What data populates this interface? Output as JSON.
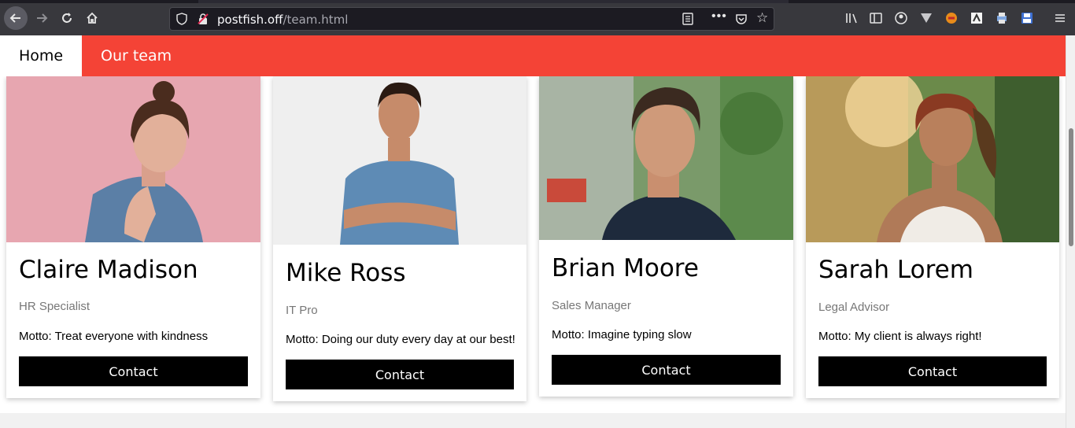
{
  "browser": {
    "url_host": "postfish.off",
    "url_path": "/team.html",
    "more_label": "•••"
  },
  "nav": {
    "home_label": "Home",
    "team_label": "Our team"
  },
  "team": [
    {
      "name": "Claire Madison",
      "role": "HR Specialist",
      "motto": "Motto: Treat everyone with kindness",
      "contact_label": "Contact"
    },
    {
      "name": "Mike Ross",
      "role": "IT Pro",
      "motto": "Motto: Doing our duty every day at our best!",
      "contact_label": "Contact"
    },
    {
      "name": "Brian Moore",
      "role": "Sales Manager",
      "motto": "Motto: Imagine typing slow",
      "contact_label": "Contact"
    },
    {
      "name": "Sarah Lorem",
      "role": "Legal Advisor",
      "motto": "Motto: My client is always right!",
      "contact_label": "Contact"
    }
  ],
  "colors": {
    "navbar_red": "#f44336",
    "button_black": "#000000"
  }
}
